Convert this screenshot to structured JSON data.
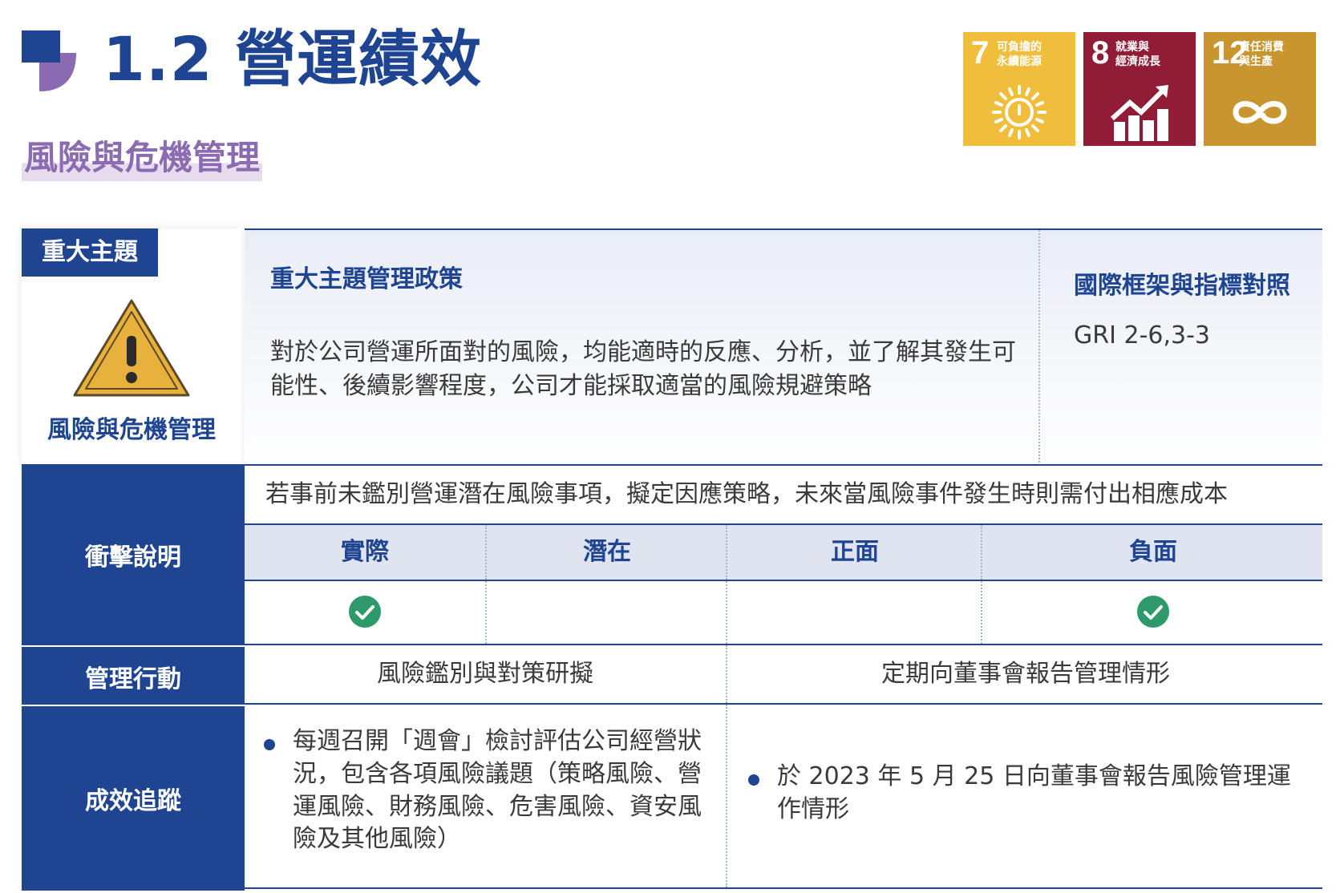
{
  "header": {
    "title": "1.2 營運績效",
    "section": "風險與危機管理"
  },
  "sdgs": [
    {
      "number": "7",
      "label": "可負擔的\n永續能源",
      "color": "#f1bd3d",
      "icon": "sun-power-icon"
    },
    {
      "number": "8",
      "label": "就業與\n經濟成長",
      "color": "#901d35",
      "icon": "growth-chart-icon"
    },
    {
      "number": "12",
      "label": "責任消費\n與生產",
      "color": "#c8952f",
      "icon": "infinity-loop-icon"
    }
  ],
  "topic": {
    "tag": "重大主題",
    "name": "風險與危機管理",
    "icon": "warning-icon"
  },
  "policy": {
    "heading": "重大主題管理政策",
    "body": "對於公司營運所面對的風險，均能適時的反應、分析，並了解其發生可能性、後續影響程度，公司才能採取適當的風險規避策略"
  },
  "framework": {
    "heading": "國際框架與指標對照",
    "body": "GRI 2-6,3-3"
  },
  "impact": {
    "label": "衝擊說明",
    "description": "若事前未鑑別營運潛在風險事項，擬定因應策略，未來當風險事件發生時則需付出相應成本",
    "columns": [
      {
        "label": "實際",
        "checked": true
      },
      {
        "label": "潛在",
        "checked": false
      },
      {
        "label": "正面",
        "checked": false
      },
      {
        "label": "負面",
        "checked": true
      }
    ]
  },
  "action": {
    "label": "管理行動",
    "items": [
      "風險鑑別與對策研擬",
      "定期向董事會報告管理情形"
    ]
  },
  "results": {
    "label": "成效追蹤",
    "items": [
      "每週召開「週會」檢討評估公司經營狀況，包含各項風險議題（策略風險、營運風險、財務風險、危害風險、資安風險及其他風險）",
      "於 2023 年 5 月 25 日向董事會報告風險管理運作情形"
    ]
  },
  "colors": {
    "primary": "#1f4592",
    "accent_purple": "#8b6bb1",
    "check_green": "#2e9a6b"
  }
}
